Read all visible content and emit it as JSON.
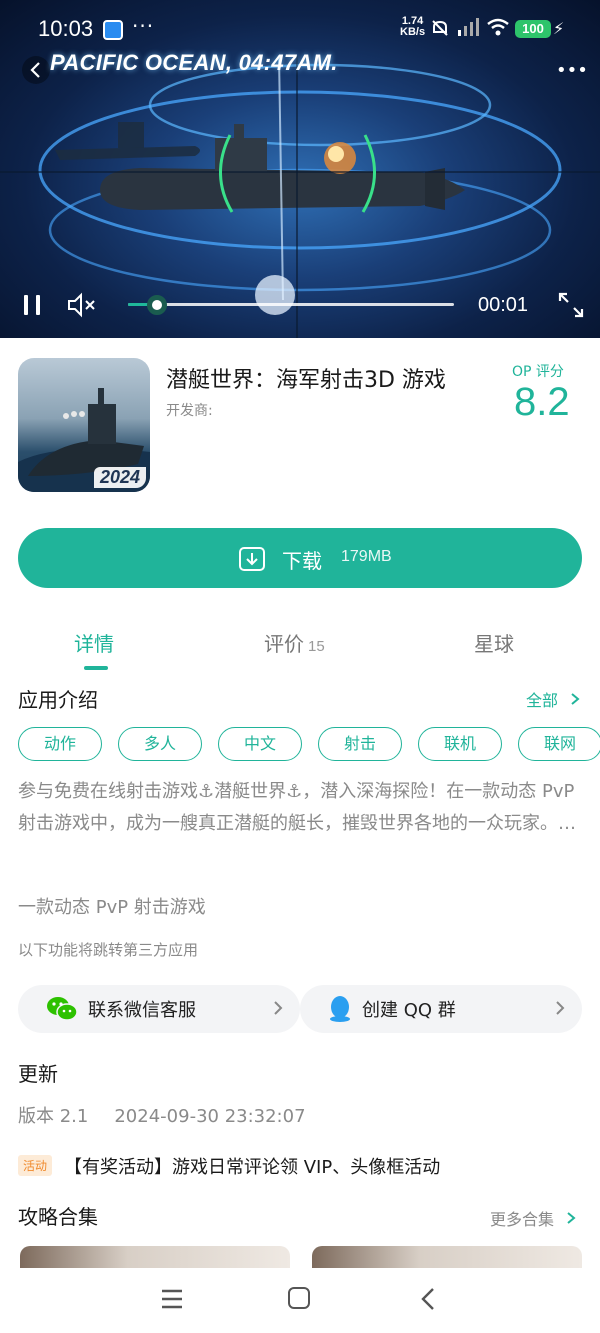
{
  "status_bar": {
    "time": "10:03",
    "dots": "···",
    "net_speed_value": "1.74",
    "net_speed_unit": "KB/s",
    "battery": "100",
    "icons": [
      "app-badge-icon",
      "bell-muted-icon",
      "signal-icon",
      "wifi-icon",
      "charging-bolt-icon"
    ]
  },
  "video": {
    "caption": "PACIFIC OCEAN, 04:47AM.",
    "current_time": "00:01",
    "progress": 0.09,
    "muted": true,
    "playing": true
  },
  "app": {
    "title": "潜艇世界：海军射击3D 游戏",
    "developer_label": "开发商:",
    "icon_badge": "2024",
    "score_label": "OP 评分",
    "score": "8.2"
  },
  "download": {
    "label": "下载",
    "size": "179MB"
  },
  "tabs": [
    {
      "label": "详情",
      "count": "",
      "active": true
    },
    {
      "label": "评价",
      "count": "15",
      "active": false
    },
    {
      "label": "星球",
      "count": "",
      "active": false
    }
  ],
  "intro": {
    "title": "应用介绍",
    "see_all": "全部",
    "tags": [
      "动作",
      "多人",
      "中文",
      "射击",
      "联机",
      "联网"
    ],
    "description": "参与免费在线射击游戏⚓潜艇世界⚓，潜入深海探险！在一款动态 PvP 射击游戏中，成为一艘真正潜艇的艇长，摧毁世界各地的一众玩家。…",
    "tagline": "一款动态 PvP 射击游戏",
    "third_party_note": "以下功能将跳转第三方应用"
  },
  "contacts": [
    {
      "label": "联系微信客服",
      "icon": "wechat-icon"
    },
    {
      "label": "创建 QQ 群",
      "icon": "qq-icon"
    }
  ],
  "update": {
    "title": "更新",
    "version": "版本 2.1",
    "date": "2024-09-30 23:32:07",
    "activity_badge": "活动",
    "activity_text": "【有奖活动】游戏日常评论领 VIP、头像框活动"
  },
  "guides": {
    "title": "攻略合集",
    "more": "更多合集"
  },
  "colors": {
    "accent": "#20b49a",
    "activity": "#f08a2d"
  }
}
